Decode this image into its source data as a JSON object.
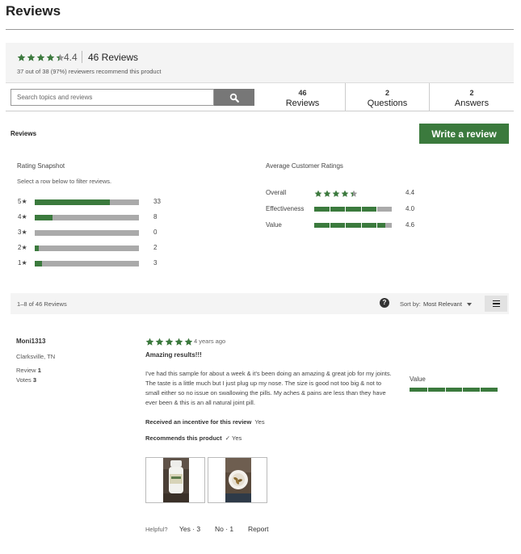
{
  "page_title": "Reviews",
  "summary": {
    "average_rating": 4.4,
    "average_label": "4.4",
    "reviews_count_label": "46 Reviews",
    "recommend_text": "37 out of 38 (97%) reviewers recommend this product"
  },
  "search": {
    "placeholder": "Search topics and reviews"
  },
  "tabs": [
    {
      "count": "46",
      "label": "Reviews"
    },
    {
      "count": "2",
      "label": "Questions"
    },
    {
      "count": "2",
      "label": "Answers"
    }
  ],
  "section_label": "Reviews",
  "write_review_label": "Write a review",
  "snapshot": {
    "title": "Rating Snapshot",
    "hint": "Select a row below to filter reviews.",
    "rows": [
      {
        "label": "5★",
        "count": "33",
        "fraction": 0.72
      },
      {
        "label": "4★",
        "count": "8",
        "fraction": 0.17
      },
      {
        "label": "3★",
        "count": "0",
        "fraction": 0
      },
      {
        "label": "2★",
        "count": "2",
        "fraction": 0.04
      },
      {
        "label": "1★",
        "count": "3",
        "fraction": 0.07
      }
    ]
  },
  "average_ratings": {
    "title": "Average Customer Ratings",
    "rows": [
      {
        "label": "Overall",
        "value": "4.4",
        "rating": 4.4
      },
      {
        "label": "Effectiveness",
        "value": "4.0",
        "rating": 4.0
      },
      {
        "label": "Value",
        "value": "4.6",
        "rating": 4.6
      }
    ]
  },
  "sort_bar": {
    "range_text": "1–8 of 46 Reviews",
    "help_glyph": "?",
    "sort_label": "Sort by:",
    "sort_value": "Most Relevant"
  },
  "review": {
    "author": "Moni1313",
    "location": "Clarksville, TN",
    "review_label": "Review",
    "review_count": "1",
    "votes_label": "Votes",
    "votes_count": "3",
    "rating": 5,
    "date": "4 years ago",
    "title": "Amazing results!!!",
    "body": "I've had this sample for about a week & it's been doing an amazing & great job for my joints. The taste is a little much but I just plug up my nose. The size is good not too big & not to small either so no issue on swallowing the pills. My aches & pains are less than they have ever been & this is an all natural joint pill.",
    "incentive_label": "Received an incentive for this review",
    "incentive_value": "Yes",
    "recommends_label": "Recommends this product",
    "recommends_value": "✓ Yes",
    "value_label": "Value",
    "value_rating": 5,
    "helpful_label": "Helpful?",
    "yes_label": "Yes · 3",
    "no_label": "No · 1",
    "report_label": "Report"
  },
  "colors": {
    "accent_green": "#3b7a3d",
    "bar_grey": "#aaaaaa"
  },
  "icons": {
    "search": "search-icon",
    "help": "help-icon",
    "menu": "menu-icon",
    "star": "star-icon"
  }
}
